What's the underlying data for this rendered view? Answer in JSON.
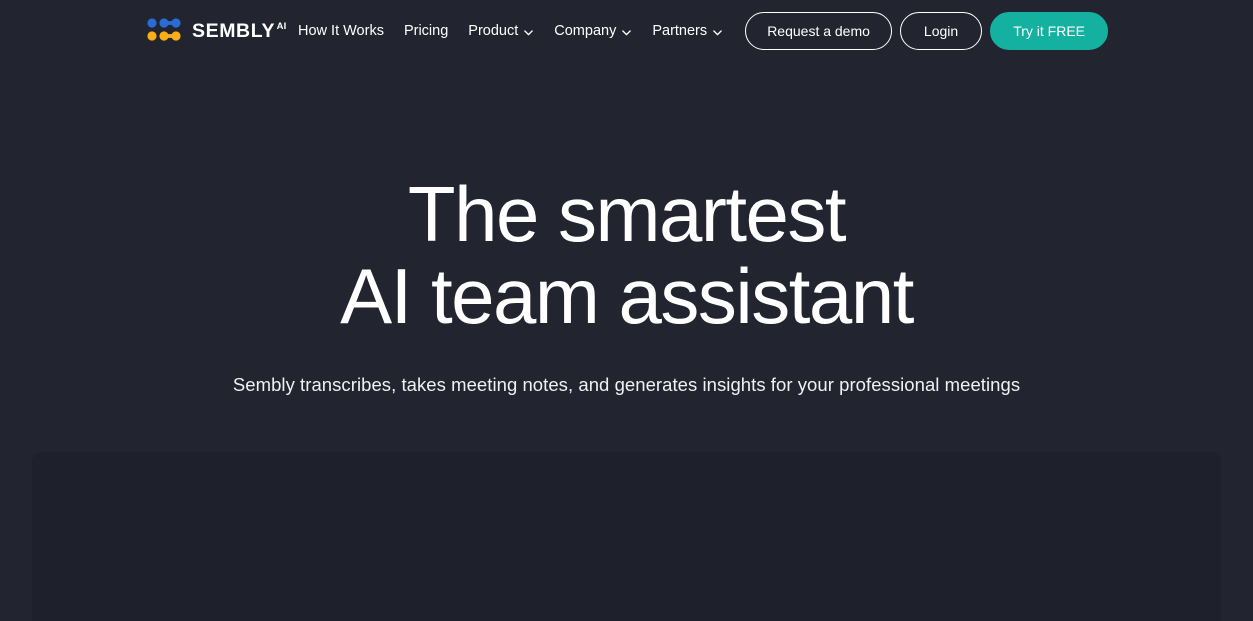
{
  "theme": {
    "background": "#22242f",
    "panel_background": "#1e202b",
    "accent_teal": "#14b0a0",
    "logo_blue": "#2a6bd4",
    "logo_yellow": "#fbaf17",
    "text_primary": "#ffffff",
    "text_secondary": "#f0f1f4"
  },
  "header": {
    "brand": {
      "logo_icon": "sembly-dots-logo",
      "name": "SEMBLY",
      "superscript": "AI"
    },
    "nav": [
      {
        "label": "How It Works",
        "has_dropdown": false
      },
      {
        "label": "Pricing",
        "has_dropdown": false
      },
      {
        "label": "Product",
        "has_dropdown": true
      },
      {
        "label": "Company",
        "has_dropdown": true
      },
      {
        "label": "Partners",
        "has_dropdown": true
      }
    ],
    "actions": {
      "request_demo": "Request a demo",
      "login": "Login",
      "try_free": "Try it FREE"
    }
  },
  "hero": {
    "title_line_1": "The smartest",
    "title_line_2": "AI team assistant",
    "subtitle": "Sembly transcribes, takes meeting notes, and generates insights for your professional meetings"
  },
  "media_panel": {
    "name": "hero-media-panel"
  }
}
